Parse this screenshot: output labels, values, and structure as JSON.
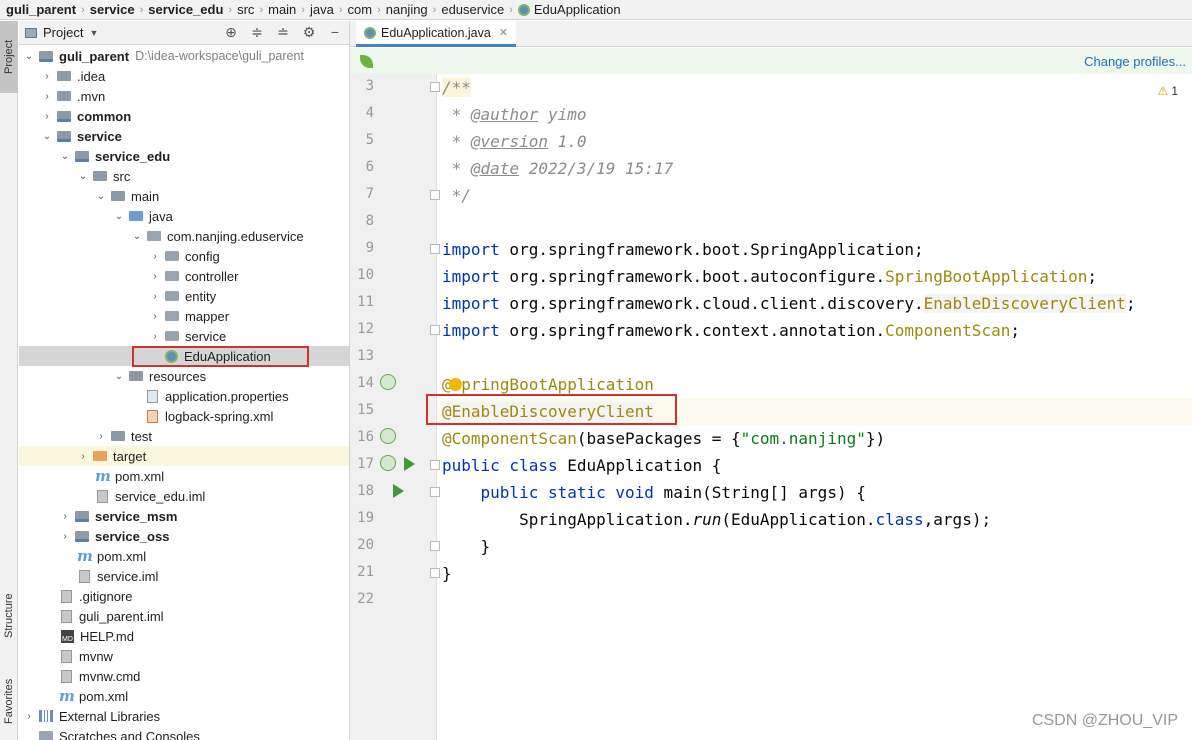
{
  "breadcrumb": [
    "guli_parent",
    "service",
    "service_edu",
    "src",
    "main",
    "java",
    "com",
    "nanjing",
    "eduservice",
    "EduApplication"
  ],
  "tool_strip": {
    "project": "Project",
    "structure": "Structure",
    "favorites": "Favorites"
  },
  "project_panel": {
    "title": "Project",
    "tree": [
      {
        "label": "guli_parent",
        "hint": "D:\\idea-workspace\\guli_parent"
      },
      {
        "label": ".idea"
      },
      {
        "label": ".mvn"
      },
      {
        "label": "common"
      },
      {
        "label": "service"
      },
      {
        "label": "service_edu"
      },
      {
        "label": "src"
      },
      {
        "label": "main"
      },
      {
        "label": "java"
      },
      {
        "label": "com.nanjing.eduservice"
      },
      {
        "label": "config"
      },
      {
        "label": "controller"
      },
      {
        "label": "entity"
      },
      {
        "label": "mapper"
      },
      {
        "label": "service"
      },
      {
        "label": "EduApplication"
      },
      {
        "label": "resources"
      },
      {
        "label": "application.properties"
      },
      {
        "label": "logback-spring.xml"
      },
      {
        "label": "test"
      },
      {
        "label": "target"
      },
      {
        "label": "pom.xml"
      },
      {
        "label": "service_edu.iml"
      },
      {
        "label": "service_msm"
      },
      {
        "label": "service_oss"
      },
      {
        "label": "pom.xml"
      },
      {
        "label": "service.iml"
      },
      {
        "label": ".gitignore"
      },
      {
        "label": "guli_parent.iml"
      },
      {
        "label": "HELP.md"
      },
      {
        "label": "mvnw"
      },
      {
        "label": "mvnw.cmd"
      },
      {
        "label": "pom.xml"
      },
      {
        "label": "External Libraries"
      },
      {
        "label": "Scratches and Consoles"
      }
    ]
  },
  "editor": {
    "tab_label": "EduApplication.java",
    "change_profiles": "Change profiles...",
    "warning_count": "1",
    "line_numbers": [
      "3",
      "4",
      "5",
      "6",
      "7",
      "8",
      "9",
      "10",
      "11",
      "12",
      "13",
      "14",
      "15",
      "16",
      "17",
      "18",
      "19",
      "20",
      "21",
      "22"
    ],
    "code": {
      "l3": "/**",
      "l4_star": " * ",
      "l4_tag": "@author",
      "l4_rest": " yimo",
      "l5_star": " * ",
      "l5_tag": "@version",
      "l5_rest": " 1.0",
      "l6_star": " * ",
      "l6_tag": "@date",
      "l6_rest": " 2022/3/19 15:17",
      "l7": " */",
      "import_kw": "import",
      "l9_pkg": " org.springframework.boot.SpringApplication;",
      "l10_pkg": " org.springframework.boot.autoconfigure.",
      "l10_cls": "SpringBootApplication",
      "l10_end": ";",
      "l11_pkg": " org.springframework.cloud.client.discovery.",
      "l11_cls": "EnableDiscoveryClient",
      "l11_end": ";",
      "l12_pkg": " org.springframework.context.annotation.",
      "l12_cls": "ComponentScan",
      "l12_end": ";",
      "l14": "@SpringBootApplication",
      "l15": "@EnableDiscoveryClient",
      "l16_ann": "@ComponentScan",
      "l16_a": "(basePackages = {",
      "l16_str": "\"com.nanjing\"",
      "l16_b": "})",
      "l17_kw": "public class",
      "l17_rest": " EduApplication {",
      "l18_indent": "    ",
      "l18_kw": "public static void",
      "l18_rest": " main(String[] args) {",
      "l19_indent": "        ",
      "l19_a": "SpringApplication.",
      "l19_m": "run",
      "l19_b": "(EduApplication.",
      "l19_kw": "class",
      "l19_c": ",args);",
      "l20": "    }",
      "l21": "}"
    }
  },
  "watermark": "CSDN @ZHOU_VIP",
  "colors": {
    "keyword": "#0033b3",
    "annotation": "#9e880d",
    "string": "#067d17",
    "comment": "#8c8c8c",
    "highlight_box": "#d32f2f"
  }
}
